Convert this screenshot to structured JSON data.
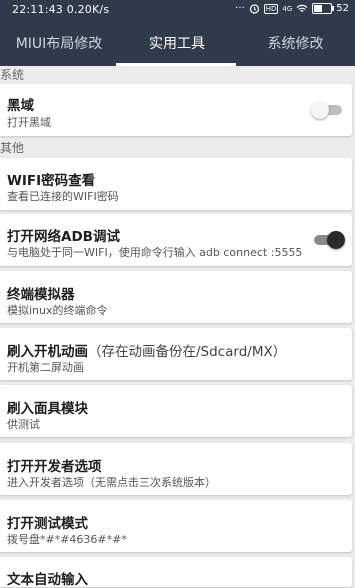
{
  "status_bar": {
    "time": "22:11:43",
    "speed": "0.20K/s",
    "network": "4G",
    "battery": "52"
  },
  "tabs": [
    {
      "label": "MIUI布局修改"
    },
    {
      "label": "实用工具"
    },
    {
      "label": "系统修改"
    }
  ],
  "active_tab": 1,
  "sections": {
    "system": "系统",
    "other": "其他"
  },
  "items": [
    {
      "title": "黑域",
      "subtitle": "打开黑域",
      "toggle": "off"
    },
    {
      "title": "WIFI密码查看",
      "subtitle": "查看已连接的WIFI密码"
    },
    {
      "title": "打开网络ADB调试",
      "subtitle": "与电脑处于同一WIFI，使用命令行输入 adb connect :5555",
      "toggle": "on"
    },
    {
      "title": "终端模拟器",
      "subtitle": "模拟inux的终端命令"
    },
    {
      "title": "刷入开机动画",
      "note": "（存在动画备份在/Sdcard/MX）",
      "subtitle": "开机第二屏动画"
    },
    {
      "title": "刷入面具模块",
      "subtitle": "供测试"
    },
    {
      "title": "打开开发者选项",
      "subtitle": "进入开发者选项（无需点击三次系统版本）"
    },
    {
      "title": "打开测试模式",
      "subtitle": "拨号盘*#*#4636#*#*"
    },
    {
      "title": "文本自动输入",
      "subtitle": ""
    }
  ],
  "colors": {
    "header_bg": "#2f3a4a",
    "page_bg": "#ececec",
    "card_bg": "#ffffff"
  }
}
